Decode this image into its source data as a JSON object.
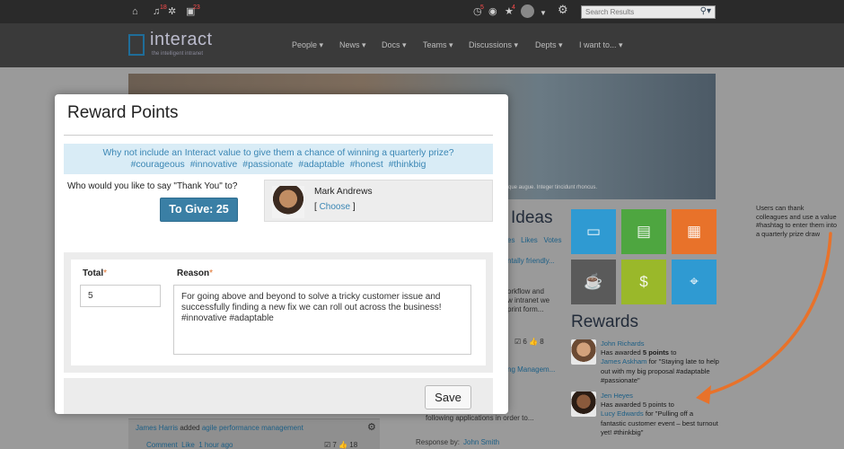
{
  "site": {
    "topbar": {
      "notif_badge_1": "18",
      "notif_badge_2": "23",
      "notif_badge_3": "5",
      "notif_badge_4": "4",
      "search_placeholder": "Search Results"
    },
    "logo_text": "interact",
    "logo_tagline": "the intelligent intranet",
    "nav": [
      "People ▾",
      "News ▾",
      "Docs ▾",
      "Teams ▾",
      "Discussions ▾",
      "Depts ▾",
      "I want to... ▾"
    ],
    "hero_caption": "tique augue. Integer tincidunt rhoncus.",
    "ideas_title": "Ideas",
    "ideas_tabs": "es   Likes   Votes",
    "ideas_link1": "ntally friendly...",
    "ideas_text": "orkflow and\nw intranet we\nprint form...",
    "ideas_stats": "☑ 6  👍 8",
    "ideas_link2": "ng Managem...",
    "office_text": "office from\nwill need the\nfollowing applications in order to...",
    "response_by": "Response by:",
    "response_name": "John Smith",
    "rewards_title": "Rewards",
    "feed": [
      {
        "name": "John Richards",
        "pre": "Has awarded",
        "points": "5 points",
        "to": "to",
        "recipient": "James Askham",
        "for": "for \"Staying late to help out with my big proposal #adaptable #passionate\""
      },
      {
        "name": "Jen Heyes",
        "pre": "Has awarded 5 points to",
        "recipient": "Lucy Edwards",
        "for": "for \"Pulling off a fantastic customer event – best turnout yet! #thinkbig\""
      }
    ],
    "bottom_post": {
      "name": "James Harris",
      "added": "added",
      "link": "agile performance management",
      "actions": "Comment  Like  1 hour ago",
      "stats": "☑ 7  👍 18"
    }
  },
  "annotation": "Users can thank colleagues and use a value #hashtag to enter them into a quarterly prize draw",
  "modal": {
    "title": "Reward Points",
    "banner_line1": "Why not include an Interact value to give them a chance of winning a quarterly prize?",
    "banner_tags": [
      "#courageous",
      "#innovative",
      "#passionate",
      "#adaptable",
      "#honest",
      "#thinkbig"
    ],
    "question": "Who would you like to say \"Thank You\" to?",
    "to_give_label": "To Give: 25",
    "recipient_name": "Mark Andrews",
    "choose_open": "[",
    "choose_label": "Choose",
    "choose_close": "]",
    "total_label": "Total",
    "total_value": "5",
    "reason_label": "Reason",
    "required_mark": "*",
    "reason_value": "For going above and beyond to solve a tricky customer issue and successfully finding a new fix we can roll out across the business! #innovative #adaptable",
    "save_label": "Save"
  },
  "colors": {
    "accent": "#3a7fa5",
    "link": "#3a86b4",
    "banner_bg": "#d9ecf6",
    "required": "#e0702a",
    "arrow": "#e8722a",
    "tiles": [
      "#2f9ad2",
      "#4ea640",
      "#e8722a",
      "#5a5a5a",
      "#9ab82a",
      "#2f9ad2"
    ]
  },
  "tile_icons": [
    "folder-icon",
    "newspaper-icon",
    "calendar-icon",
    "coffee-icon",
    "money-icon",
    "map-pin-icon"
  ]
}
